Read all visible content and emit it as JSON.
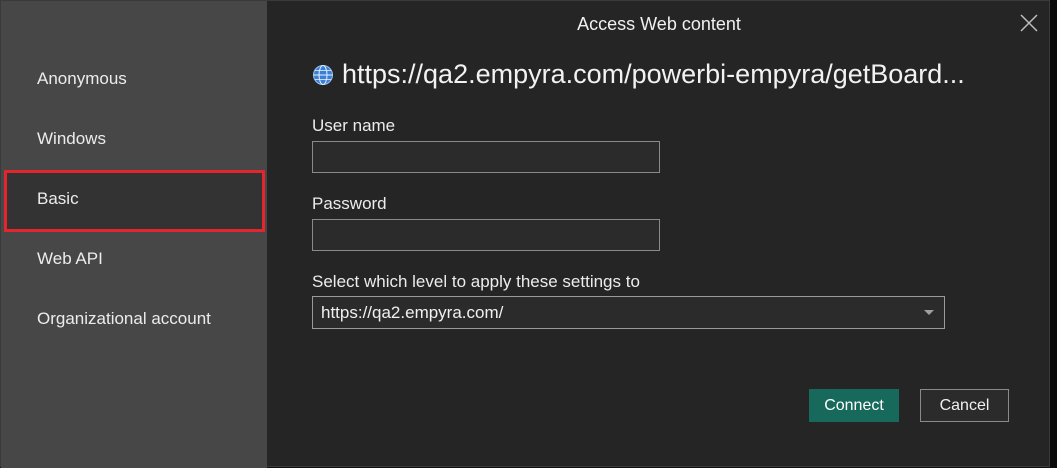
{
  "dialog": {
    "title": "Access Web content",
    "url": "https://qa2.empyra.com/powerbi-empyra/getBoard...",
    "close_icon": "close-icon",
    "globe_icon": "globe-icon"
  },
  "sidebar": {
    "items": [
      {
        "label": "Anonymous"
      },
      {
        "label": "Windows"
      },
      {
        "label": "Basic",
        "selected": true
      },
      {
        "label": "Web API"
      },
      {
        "label": "Organizational account"
      }
    ],
    "selection_highlight_color": "#e3262d"
  },
  "form": {
    "username_label": "User name",
    "username_value": "",
    "password_label": "Password",
    "password_value": "",
    "level_label": "Select which level to apply these settings to",
    "level_value": "https://qa2.empyra.com/"
  },
  "buttons": {
    "connect_label": "Connect",
    "cancel_label": "Cancel"
  },
  "colors": {
    "accent": "#176a5b"
  }
}
